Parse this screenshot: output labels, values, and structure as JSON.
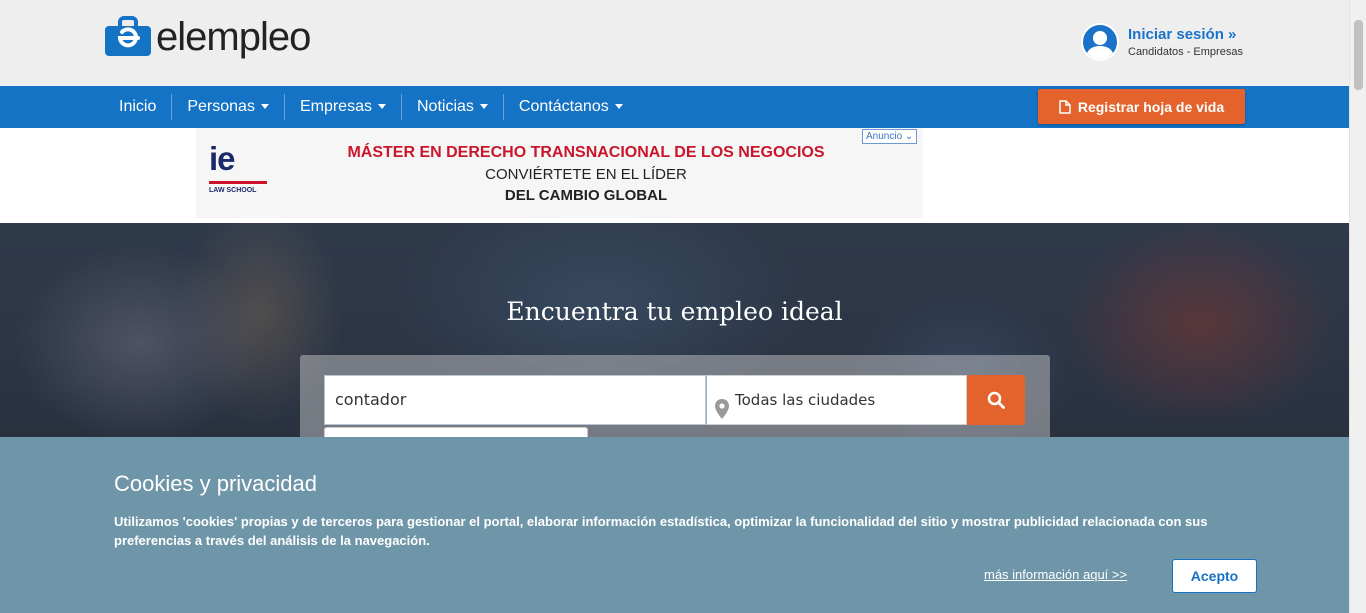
{
  "header": {
    "logo_text": "elempleo",
    "login_title": "Iniciar sesión »",
    "login_subtitle": "Candidatos - Empresas"
  },
  "nav": {
    "items": [
      {
        "label": "Inicio",
        "dropdown": false
      },
      {
        "label": "Personas",
        "dropdown": true
      },
      {
        "label": "Empresas",
        "dropdown": true
      },
      {
        "label": "Noticias",
        "dropdown": true
      },
      {
        "label": "Contáctanos",
        "dropdown": true
      }
    ],
    "register_label": "Registrar hoja de vida"
  },
  "ad": {
    "logo": "ie",
    "logo_sub": "LAW SCHOOL",
    "line1": "MÁSTER EN DERECHO TRANSNACIONAL DE LOS NEGOCIOS",
    "line2": "CONVIÉRTETE EN EL LÍDER",
    "line3": "DEL CAMBIO GLOBAL",
    "badge": "Anuncio"
  },
  "hero": {
    "title": "Encuentra tu empleo ideal",
    "search_value": "contador",
    "city_value": "Todas las ciudades"
  },
  "cookies": {
    "title": "Cookies y privacidad",
    "text": "Utilizamos 'cookies' propias y de terceros para gestionar el portal, elaborar información estadística, optimizar la funcionalidad del sitio y mostrar publicidad relacionada con sus preferencias a través del análisis de la navegación.",
    "more_link": "más información aquí >>",
    "accept_label": "Acepto"
  },
  "colors": {
    "brand_blue": "#1473c4",
    "accent_orange": "#e4622b",
    "cookie_bg": "#6f96a8"
  }
}
